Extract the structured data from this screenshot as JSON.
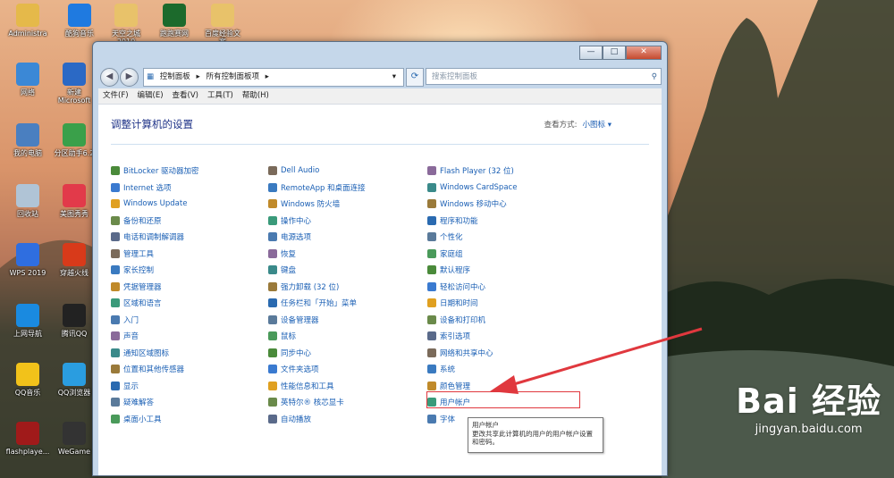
{
  "desktop": {
    "icons": [
      {
        "label": "Administra",
        "color": "#e5b94a"
      },
      {
        "label": "酷狗音乐",
        "color": "#1f7ae0"
      },
      {
        "label": "天空之城\n2010",
        "color": "#e8c26a"
      },
      {
        "label": "跑跑赛网",
        "color": "#1c6a2c"
      },
      {
        "label": "百度经验文\n案",
        "color": "#e8c26a"
      },
      {
        "label": "网络",
        "color": "#3b88d6"
      },
      {
        "label": "新建\nMicrosoft",
        "color": "#2b69c5"
      },
      {
        "label": "我的电脑",
        "color": "#4a7fc0"
      },
      {
        "label": "分区助手6.2",
        "color": "#3aa04a"
      },
      {
        "label": "回收站",
        "color": "#b0c4d6"
      },
      {
        "label": "美图秀秀",
        "color": "#e23a4a"
      },
      {
        "label": "WPS 2019",
        "color": "#2f6ee0"
      },
      {
        "label": "穿越火线",
        "color": "#d83a1a"
      },
      {
        "label": "上网导航",
        "color": "#1a8ae0"
      },
      {
        "label": "腾讯QQ",
        "color": "#222222"
      },
      {
        "label": "QQ音乐",
        "color": "#f2c21a"
      },
      {
        "label": "QQ浏览器",
        "color": "#2a9de0"
      },
      {
        "label": "flashplaye...",
        "color": "#a01a1a"
      },
      {
        "label": "WeGame",
        "color": "#333333"
      }
    ]
  },
  "window": {
    "caption_buttons": [
      "—",
      "□",
      "✕"
    ],
    "address": {
      "segments": [
        "控制面板",
        "▸",
        "所有控制面板项",
        "▸"
      ],
      "search_placeholder": "搜索控制面板"
    },
    "menu": [
      "文件(F)",
      "编辑(E)",
      "查看(V)",
      "工具(T)",
      "帮助(H)"
    ],
    "heading": "调整计算机的设置",
    "view_label": "查看方式:",
    "view_value": "小图标 ▾",
    "columns": [
      [
        "BitLocker 驱动器加密",
        "Internet 选项",
        "Windows Update",
        "备份和还原",
        "电话和调制解调器",
        "管理工具",
        "家长控制",
        "凭据管理器",
        "区域和语言",
        "入门",
        "声音",
        "通知区域图标",
        "位置和其他传感器",
        "显示",
        "疑难解答",
        "桌面小工具"
      ],
      [
        "Dell Audio",
        "RemoteApp 和桌面连接",
        "Windows 防火墙",
        "操作中心",
        "电源选项",
        "恢复",
        "键盘",
        "强力卸载 (32 位)",
        "任务栏和「开始」菜单",
        "设备管理器",
        "鼠标",
        "同步中心",
        "文件夹选项",
        "性能信息和工具",
        "英特尔® 核芯显卡",
        "自动播放"
      ],
      [
        "Flash Player (32 位)",
        "Windows CardSpace",
        "Windows 移动中心",
        "程序和功能",
        "个性化",
        "家庭组",
        "默认程序",
        "轻松访问中心",
        "日期和时间",
        "设备和打印机",
        "索引选项",
        "网络和共享中心",
        "系统",
        "颜色管理",
        "用户帐户",
        "字体"
      ]
    ],
    "icon_colors": [
      "#4a8a3a",
      "#3a7ad0",
      "#e0a020",
      "#6a8a4a",
      "#5a6a8a",
      "#7a6a5a",
      "#3a7ac0",
      "#c08a2a",
      "#3a9a7a",
      "#4a7ab0",
      "#8a6a9a",
      "#3a8a8a",
      "#9a7a3a",
      "#2a6ab0",
      "#5a7a9a",
      "#4a9a5a"
    ],
    "tooltip": {
      "title": "用户帐户",
      "body": "更改共享此计算机的用户的用户帐户设置和密码。"
    }
  },
  "watermark": {
    "logo": "Bai 经验",
    "url": "jingyan.baidu.com"
  },
  "accent": "#1a5fb4",
  "highlight_color": "#e0383e"
}
